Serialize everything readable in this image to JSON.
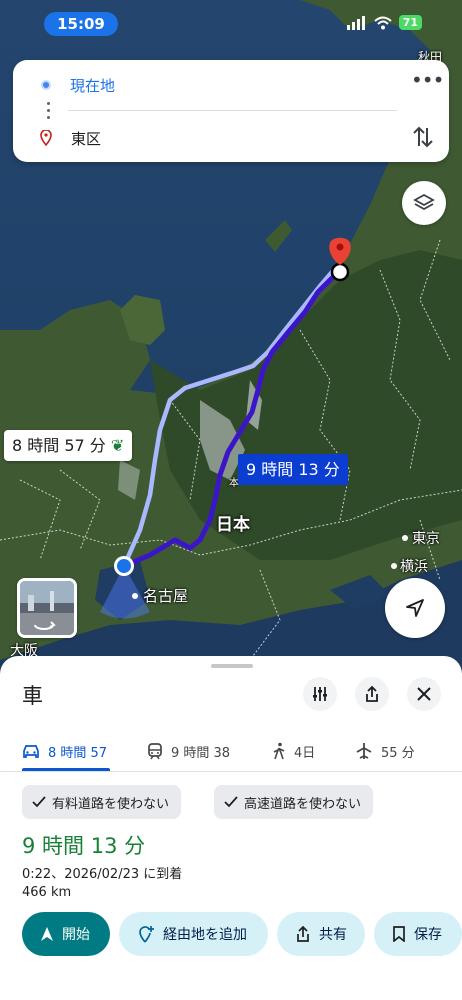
{
  "status_bar": {
    "time": "15:09",
    "battery": "71"
  },
  "search": {
    "origin": "現在地",
    "destination": "東区"
  },
  "map": {
    "alt_route_time": "8 時間 57 分",
    "main_route_time": "9 時間 13 分",
    "labels": {
      "nihon": "日本",
      "nagoya": "名古屋",
      "tokyo": "東京",
      "yokohama": "横浜",
      "osaka": "大阪",
      "akita": "秋田",
      "motosu": "本"
    }
  },
  "sheet": {
    "title": "車",
    "tabs": [
      {
        "label": "8 時間 57",
        "icon": "car-icon"
      },
      {
        "label": "9 時間 38",
        "icon": "transit-icon"
      },
      {
        "label": "4日",
        "icon": "walk-icon"
      },
      {
        "label": "55 分",
        "icon": "flight-icon"
      }
    ],
    "chips": [
      "有料道路を使わない",
      "高速道路を使わない"
    ],
    "duration": "9 時間 13 分",
    "arrival": "0:22、2026/02/23 に到着",
    "distance": "466 km",
    "actions": {
      "start": "開始",
      "add_stop": "経由地を追加",
      "share": "共有",
      "save": "保存"
    }
  },
  "colors": {
    "route_main": "#3b16c9",
    "route_alt": "#a9b8ff",
    "accent_green": "#188038",
    "start_btn": "#007b83"
  }
}
